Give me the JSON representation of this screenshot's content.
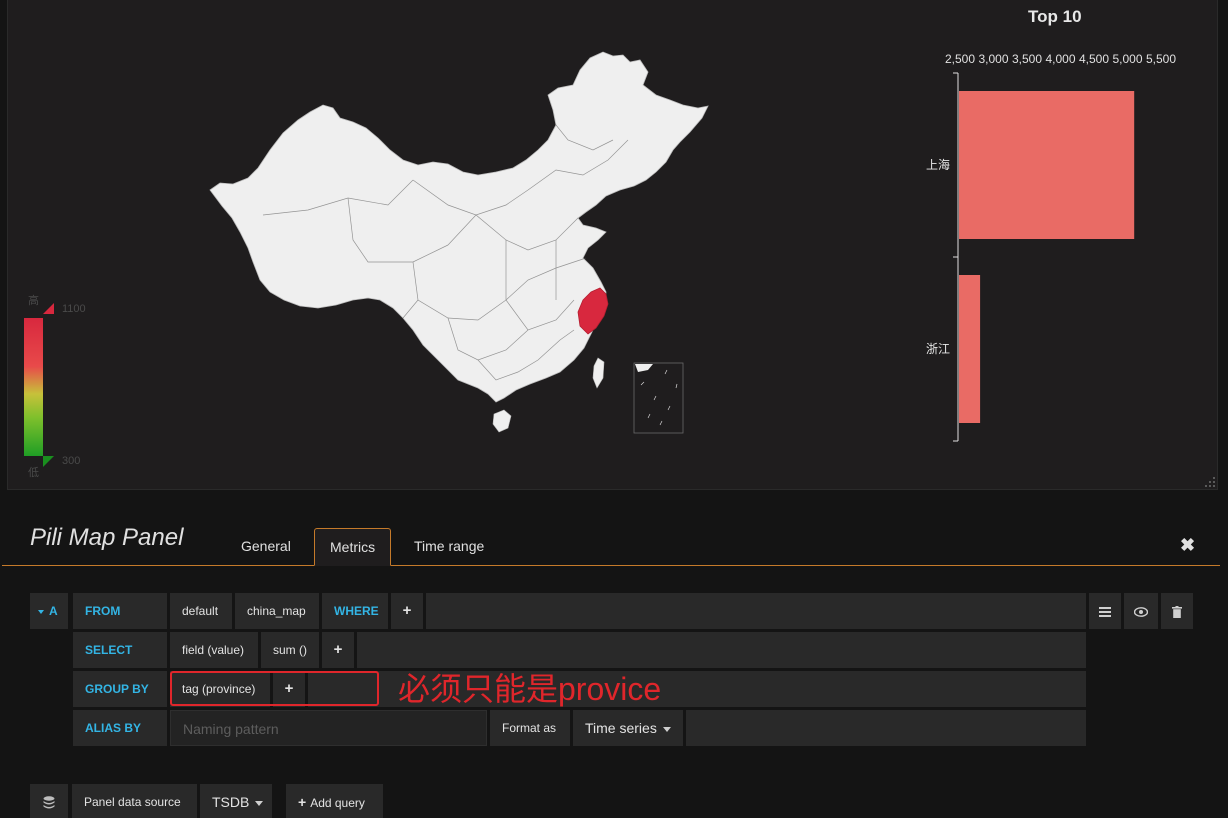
{
  "map": {
    "legend_high_label": "高",
    "legend_low_label": "低",
    "legend_max": "1100",
    "legend_min": "300",
    "highlight_color": "#d8283e",
    "land_color": "#efefef"
  },
  "chart_data": {
    "type": "bar",
    "title": "Top 10",
    "orientation": "horizontal",
    "categories": [
      "上海",
      "浙江"
    ],
    "values": [
      5100,
      2800
    ],
    "xlim": [
      2500,
      5500
    ],
    "xticks": [
      "2,500",
      "3,000",
      "3,500",
      "4,000",
      "4,500",
      "5,000",
      "5,500"
    ],
    "bar_color": "#e96b65"
  },
  "editor": {
    "title": "Pili Map Panel",
    "tabs": [
      {
        "label": "General"
      },
      {
        "label": "Metrics"
      },
      {
        "label": "Time range"
      }
    ],
    "close": "✖"
  },
  "query": {
    "ref": "A",
    "from_kw": "FROM",
    "policy": "default",
    "measurement": "china_map",
    "where_kw": "WHERE",
    "plus": "+",
    "select_kw": "SELECT",
    "field": "field (value)",
    "func": "sum ()",
    "group_kw": "GROUP BY",
    "group_tag": "tag (province)",
    "alias_kw": "ALIAS BY",
    "alias_placeholder": "Naming pattern",
    "format_label": "Format as",
    "format_value": "Time series",
    "annotation": "必须只能是provice"
  },
  "footer": {
    "datasource_label": "Panel data source",
    "datasource_value": "TSDB",
    "add_query": "Add query"
  }
}
